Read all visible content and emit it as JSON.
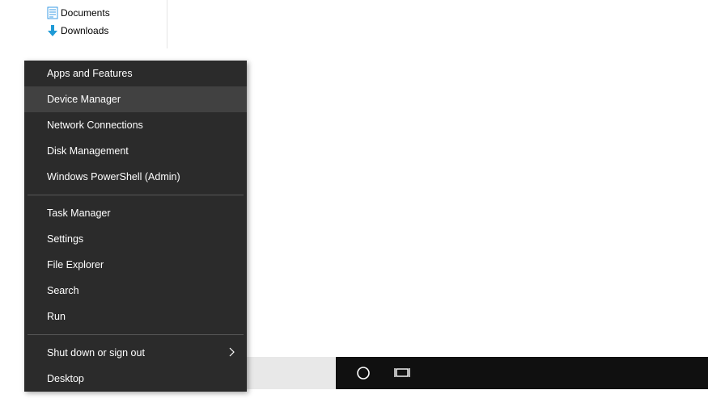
{
  "explorer": {
    "items": [
      {
        "label": "Documents"
      },
      {
        "label": "Downloads"
      }
    ]
  },
  "menu": {
    "group1": [
      {
        "label": "Apps and Features",
        "hover": false
      },
      {
        "label": "Device Manager",
        "hover": true
      },
      {
        "label": "Network Connections",
        "hover": false
      },
      {
        "label": "Disk Management",
        "hover": false
      },
      {
        "label": "Windows PowerShell (Admin)",
        "hover": false
      }
    ],
    "group2": [
      {
        "label": "Task Manager"
      },
      {
        "label": "Settings"
      },
      {
        "label": "File Explorer"
      },
      {
        "label": "Search"
      },
      {
        "label": "Run"
      }
    ],
    "group3": [
      {
        "label": "Shut down or sign out",
        "submenu": true
      },
      {
        "label": "Desktop"
      }
    ]
  }
}
